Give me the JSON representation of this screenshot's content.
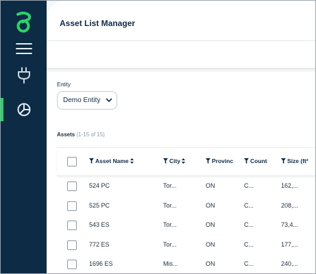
{
  "app": {
    "title": "Asset List Manager"
  },
  "sidebar": {
    "logo": "brand-logo",
    "items": [
      {
        "icon": "menu-icon"
      },
      {
        "icon": "plug-icon"
      },
      {
        "icon": "pie-chart-icon",
        "active": true
      }
    ]
  },
  "entity": {
    "label": "Entity",
    "selected": "Demo Entity"
  },
  "assets": {
    "title": "Assets",
    "count": "(1-15 of 15)"
  },
  "table": {
    "headers": {
      "name": "Asset Name",
      "city": "City",
      "province": "Provinc",
      "country": "Count",
      "size": "Size (ft²"
    },
    "rows": [
      {
        "name": "524 PC",
        "city": "Tor...",
        "province": "ON",
        "country": "C...",
        "size": "162,..."
      },
      {
        "name": "525 PC",
        "city": "Tor...",
        "province": "ON",
        "country": "C...",
        "size": "208,..."
      },
      {
        "name": "543 ES",
        "city": "Tor...",
        "province": "ON",
        "country": "C...",
        "size": "73,4..."
      },
      {
        "name": "772 ES",
        "city": "Tor...",
        "province": "ON",
        "country": "C...",
        "size": "177,..."
      },
      {
        "name": "1696 ES",
        "city": "Mis...",
        "province": "ON",
        "country": "C...",
        "size": "240,..."
      }
    ]
  },
  "colors": {
    "sidebar": "#0d2b45",
    "accent": "#2bd46a",
    "title": "#0d2b45"
  }
}
